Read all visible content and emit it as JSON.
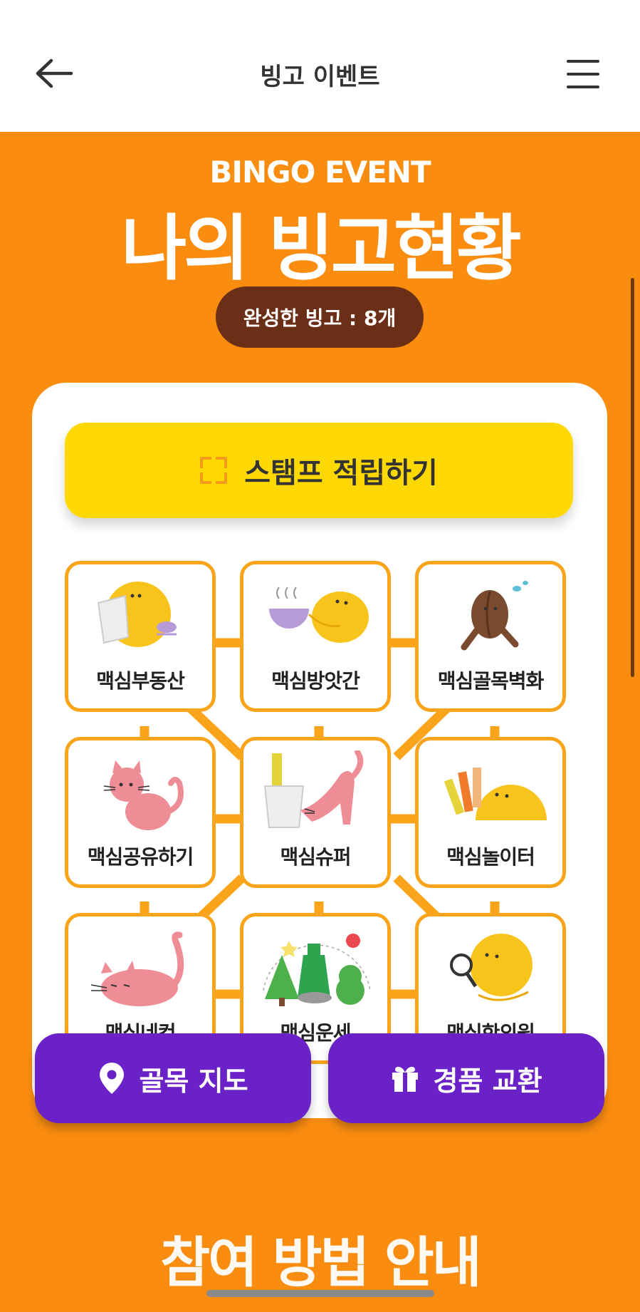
{
  "header": {
    "title": "빙고 이벤트",
    "back_icon": "arrow-left-icon",
    "menu_icon": "hamburger-menu-icon"
  },
  "hero": {
    "subtitle": "BINGO EVENT",
    "title": "나의 빙고현황",
    "completed_label": "완성한 빙고 : 8개"
  },
  "stamp_button": {
    "label": "스탬프 적립하기",
    "icon": "scan-frame-icon"
  },
  "bingo": {
    "cells": [
      {
        "label": "맥심부동산",
        "icon": "mascot-reading-icon"
      },
      {
        "label": "맥심방앗간",
        "icon": "mascot-coffee-cup-icon"
      },
      {
        "label": "맥심골목벽화",
        "icon": "coffee-bean-character-icon"
      },
      {
        "label": "맥심공유하기",
        "icon": "pink-cat-sitting-icon"
      },
      {
        "label": "맥심슈퍼",
        "icon": "pink-cat-stretching-icon"
      },
      {
        "label": "맥심놀이터",
        "icon": "mascot-coffee-sticks-icon"
      },
      {
        "label": "맥심네컷",
        "icon": "pink-cat-lying-icon"
      },
      {
        "label": "맥심운세",
        "icon": "bottle-trees-icon"
      },
      {
        "label": "맥심한의원",
        "icon": "mascot-magnifier-icon"
      }
    ]
  },
  "background_text": "참여 방법 안내",
  "bottom_buttons": {
    "map": {
      "label": "골목 지도",
      "icon": "location-pin-icon"
    },
    "exchange": {
      "label": "경품 교환",
      "icon": "gift-icon"
    }
  },
  "colors": {
    "orange": "#FA8D10",
    "brown_pill": "#6B2E17",
    "yellow_button": "#FDD803",
    "purple_button": "#6A22C8",
    "cell_border": "#F9A41A"
  }
}
